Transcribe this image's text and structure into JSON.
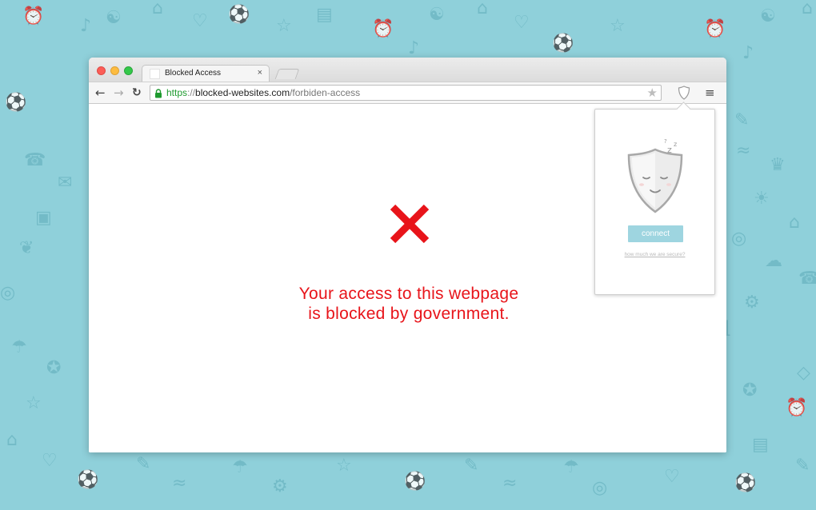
{
  "tab": {
    "title": "Blocked Access",
    "close_label": "×"
  },
  "toolbar": {
    "back_label": "←",
    "forward_label": "→",
    "reload_label": "↻",
    "menu_label": "≡",
    "star_label": "★"
  },
  "address_bar": {
    "scheme": "https",
    "separator": "://",
    "host": "blocked-websites.com",
    "path": "/forbiden-access"
  },
  "page": {
    "message_line1": "Your access to this webpage",
    "message_line2": "is blocked by government."
  },
  "popup": {
    "connect_label": "connect",
    "secure_link": "how much we are secure?"
  },
  "colors": {
    "background": "#8fd0da",
    "block_red": "#e8141a",
    "url_green": "#1f9a2f",
    "connect_button": "#9ed5e0"
  }
}
